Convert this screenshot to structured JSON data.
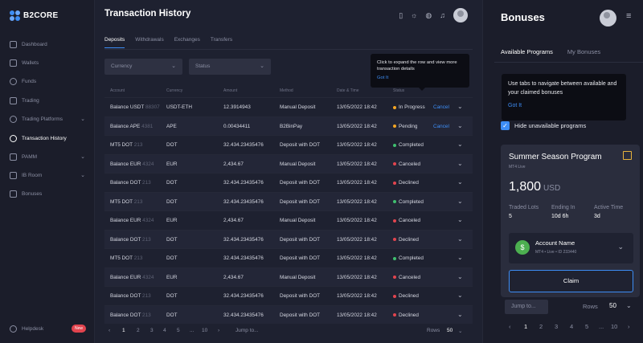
{
  "brand": {
    "name": "B2CORE"
  },
  "sidebar": {
    "items": [
      {
        "label": "Dashboard"
      },
      {
        "label": "Wallets"
      },
      {
        "label": "Funds"
      },
      {
        "label": "Trading"
      },
      {
        "label": "Trading Platforms"
      },
      {
        "label": "Transaction History"
      },
      {
        "label": "PAMM"
      },
      {
        "label": "IB Room"
      },
      {
        "label": "Bonuses"
      }
    ],
    "helpdesk": {
      "label": "Helpdesk",
      "badge": "New"
    }
  },
  "main": {
    "title": "Transaction History",
    "tabs": [
      {
        "label": "Deposits"
      },
      {
        "label": "Withdrawals"
      },
      {
        "label": "Exchanges"
      },
      {
        "label": "Transfers"
      }
    ],
    "filters": {
      "currency": "Currency",
      "status": "Status"
    },
    "columns": [
      "Account",
      "Currency",
      "Amount",
      "Method",
      "Date & Time",
      "Status"
    ],
    "rows": [
      {
        "account": "Balance USDT",
        "id": "88307",
        "currency": "USDT-ETH",
        "amount": "12.3914943",
        "method": "Manual Deposit",
        "date": "13/05/2022 18:42",
        "status": "In Progress",
        "action": "Cancel"
      },
      {
        "account": "Balance APE",
        "id": "4381",
        "currency": "APE",
        "amount": "0.00434411",
        "method": "B2BinPay",
        "date": "13/05/2022 18:42",
        "status": "Pending",
        "action": "Cancel"
      },
      {
        "account": "MT5 DOT",
        "id": "213",
        "currency": "DOT",
        "amount": "32.434.23435476",
        "method": "Deposit with DOT",
        "date": "13/05/2022 18:42",
        "status": "Completed",
        "action": ""
      },
      {
        "account": "Balance EUR",
        "id": "4324",
        "currency": "EUR",
        "amount": "2,434.67",
        "method": "Manual Deposit",
        "date": "13/05/2022 18:42",
        "status": "Canceled",
        "action": ""
      },
      {
        "account": "Balance DOT",
        "id": "213",
        "currency": "DOT",
        "amount": "32.434.23435476",
        "method": "Deposit with DOT",
        "date": "13/05/2022 18:42",
        "status": "Declined",
        "action": ""
      },
      {
        "account": "MT5 DOT",
        "id": "213",
        "currency": "DOT",
        "amount": "32.434.23435476",
        "method": "Deposit with DOT",
        "date": "13/05/2022 18:42",
        "status": "Completed",
        "action": ""
      },
      {
        "account": "Balance EUR",
        "id": "4324",
        "currency": "EUR",
        "amount": "2,434.67",
        "method": "Manual Deposit",
        "date": "13/05/2022 18:42",
        "status": "Canceled",
        "action": ""
      },
      {
        "account": "Balance DOT",
        "id": "213",
        "currency": "DOT",
        "amount": "32.434.23435476",
        "method": "Deposit with DOT",
        "date": "13/05/2022 18:42",
        "status": "Declined",
        "action": ""
      },
      {
        "account": "MT5 DOT",
        "id": "213",
        "currency": "DOT",
        "amount": "32.434.23435476",
        "method": "Deposit with DOT",
        "date": "13/05/2022 18:42",
        "status": "Completed",
        "action": ""
      },
      {
        "account": "Balance EUR",
        "id": "4324",
        "currency": "EUR",
        "amount": "2,434.67",
        "method": "Manual Deposit",
        "date": "13/05/2022 18:42",
        "status": "Canceled",
        "action": ""
      },
      {
        "account": "Balance DOT",
        "id": "213",
        "currency": "DOT",
        "amount": "32.434.23435476",
        "method": "Deposit with DOT",
        "date": "13/05/2022 18:42",
        "status": "Declined",
        "action": ""
      },
      {
        "account": "Balance DOT",
        "id": "213",
        "currency": "DOT",
        "amount": "32.434.23435476",
        "method": "Deposit with DOT",
        "date": "13/05/2022 18:42",
        "status": "Declined",
        "action": ""
      }
    ],
    "tooltip": {
      "text": "Click to expand the row and view more transaction details",
      "action": "Got It"
    },
    "pager": {
      "pages": [
        "1",
        "2",
        "3",
        "4",
        "5",
        "...",
        "10"
      ],
      "current": "1",
      "jump": "Jump to...",
      "rows_label": "Rows",
      "rows_value": "50"
    }
  },
  "status_colors": {
    "In Progress": "#f5a623",
    "Pending": "#f5a623",
    "Completed": "#3fbf6f",
    "Canceled": "#e2444e",
    "Declined": "#e2444e"
  },
  "bonuses": {
    "title": "Bonuses",
    "tabs": [
      {
        "label": "Available Programs"
      },
      {
        "label": "My Bonuses"
      }
    ],
    "tooltip": {
      "text": "Use tabs to navigate between available and your claimed bonuses",
      "action": "Got It"
    },
    "checkbox": {
      "label": "Hide unavailable programs",
      "checked": true
    },
    "card": {
      "title": "Summer Season Program",
      "subtitle": "MT4 Live",
      "amount": "1,800",
      "currency": "USD",
      "stats": [
        {
          "label": "Traded Lots",
          "value": "5"
        },
        {
          "label": "Ending In",
          "value": "10d 6h"
        },
        {
          "label": "Active Time",
          "value": "3d"
        }
      ],
      "account": {
        "name": "Account Name",
        "sub": "MT4 • Live • ID 233440"
      },
      "claim": "Claim"
    },
    "pager": {
      "jump": "Jump to...",
      "rows_label": "Rows",
      "rows_value": "50",
      "pages": [
        "1",
        "2",
        "3",
        "4",
        "5",
        "...",
        "10"
      ],
      "current": "1"
    }
  }
}
